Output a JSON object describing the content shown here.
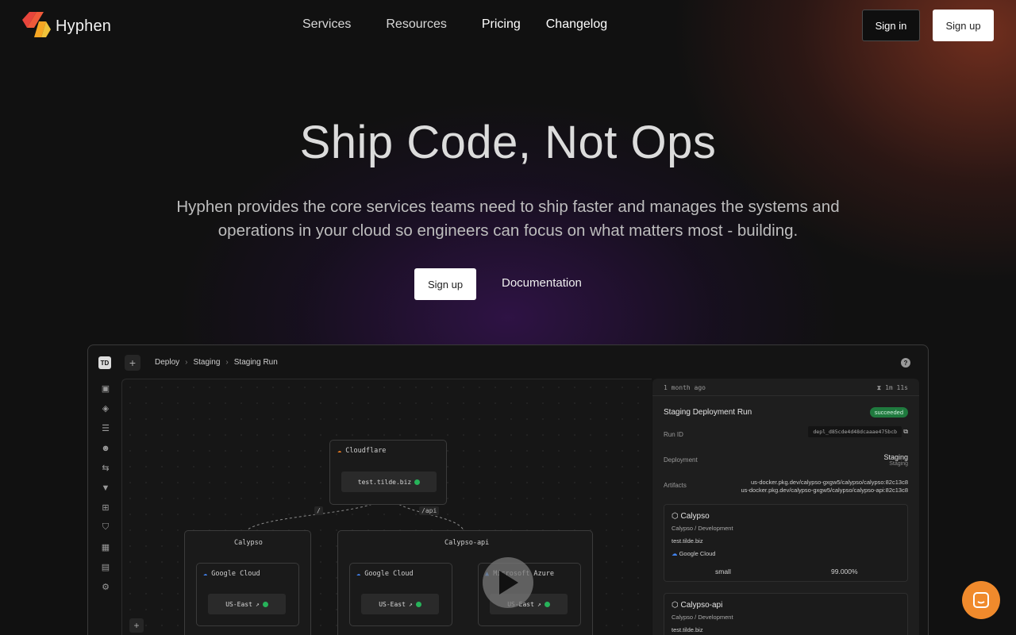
{
  "brand": {
    "name": "Hyphen",
    "accent_colors": [
      "#e8453c",
      "#f6a623"
    ]
  },
  "nav": {
    "links": [
      {
        "label": "Services",
        "has_dropdown": true
      },
      {
        "label": "Resources",
        "has_dropdown": true
      },
      {
        "label": "Pricing",
        "has_dropdown": false
      },
      {
        "label": "Changelog",
        "has_dropdown": false
      }
    ],
    "signin_label": "Sign in",
    "signup_label": "Sign up"
  },
  "hero": {
    "title": "Ship Code, Not Ops",
    "subtitle": "Hyphen provides the core services teams need to ship faster and manages the systems and operations in your cloud so engineers can focus on what matters most - building.",
    "cta_primary": "Sign up",
    "cta_secondary": "Documentation"
  },
  "preview": {
    "app_logo": "TD",
    "breadcrumb": [
      "Deploy",
      "Staging",
      "Staging Run"
    ],
    "sidebar_icons": [
      "layout-icon",
      "cube-icon",
      "docs-icon",
      "users-icon",
      "link-icon",
      "filter-icon",
      "grid-icon",
      "shield-icon",
      "apps-icon",
      "file-icon",
      "settings-icon"
    ],
    "canvas": {
      "nodes": {
        "cloudflare": {
          "title": "Cloudflare",
          "chip": "test.tilde.biz"
        },
        "calypso": {
          "title": "Calypso",
          "provider": "Google Cloud",
          "region": "US-East"
        },
        "calypso_api": {
          "title": "Calypso-api",
          "provider_1": "Google Cloud",
          "region_1": "US-East",
          "provider_2": "Microsoft Azure",
          "region_2": "US-East"
        }
      },
      "edge_labels": [
        "/",
        "/api"
      ]
    },
    "panel": {
      "age": "1 month ago",
      "duration": "1m 11s",
      "title": "Staging Deployment Run",
      "status": "succeeded",
      "run_id_label": "Run ID",
      "run_id": "depl_d85cde4d48dcaaae475bcb",
      "deployment_label": "Deployment",
      "deployment_value": "Staging",
      "deployment_sub": "Staging",
      "artifacts_label": "Artifacts",
      "artifacts": [
        "us-docker.pkg.dev/calypso-gxgw5/calypso/calypso:82c13c8",
        "us-docker.pkg.dev/calypso-gxgw5/calypso/calypso-api:82c13c8"
      ],
      "cards": [
        {
          "title": "Calypso",
          "path": "Calypso / Development",
          "domain": "test.tilde.biz",
          "provider": "Google Cloud",
          "size": "small",
          "percent": "99.000%"
        },
        {
          "title": "Calypso-api",
          "path": "Calypso / Development",
          "domain": "test.tilde.biz"
        }
      ]
    }
  }
}
